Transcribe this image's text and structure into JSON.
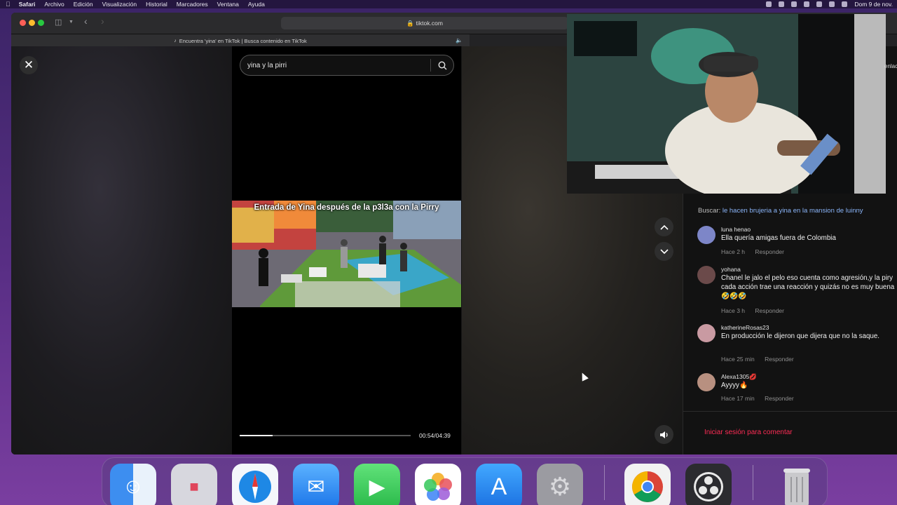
{
  "menubar": {
    "app": "Safari",
    "items": [
      "Archivo",
      "Edición",
      "Visualización",
      "Historial",
      "Marcadores",
      "Ventana",
      "Ayuda"
    ],
    "clock": "Dom 9 de nov."
  },
  "browser": {
    "url": "tiktok.com",
    "tab_title": "Encuentra 'yina' en TikTok | Busca contenido en TikTok"
  },
  "player": {
    "search_value": "yina y la pirri",
    "caption": "Entrada de Yina después de la p3l3a con la Pirry",
    "time": "00:54/04:39",
    "progress": 0.193
  },
  "comments": {
    "search_prefix": "Buscar:",
    "search_query": "le hacen brujeria a yina en la mansion de luinny",
    "reply_label": "Responder",
    "items": [
      {
        "user": "luna henao",
        "text": "Ella quería amigas fuera de Colombia",
        "time": "Hace 2 h",
        "avatar_color": "#7d86c8"
      },
      {
        "user": "yohana",
        "text": "Chanel le jalo el pelo eso cuenta como agresión,y la piry cada acción trae una reacción y quizás no es muy buena 🤣🤣🤣",
        "time": "Hace 3 h",
        "avatar_color": "#6b4a4a"
      },
      {
        "user": "katherineRosas23",
        "text": "En producción le dijeron que dijera que no la saque.",
        "time": "Hace 25 min",
        "avatar_color": "#c99aa2"
      },
      {
        "user": "Alexa1305💋",
        "text": "Ayyyy🔥",
        "time": "Hace 17 min",
        "avatar_color": "#b89080"
      }
    ],
    "login_cta": "Iniciar sesión para comentar"
  },
  "dock": {
    "apps": [
      "finder-icon",
      "launchpad-icon",
      "safari-icon",
      "mail-icon",
      "facetime-icon",
      "photos-icon",
      "app-store-icon",
      "system-settings-icon",
      "chrome-icon",
      "obs-icon",
      "trash-icon"
    ]
  },
  "right_edge_text": "enlace"
}
